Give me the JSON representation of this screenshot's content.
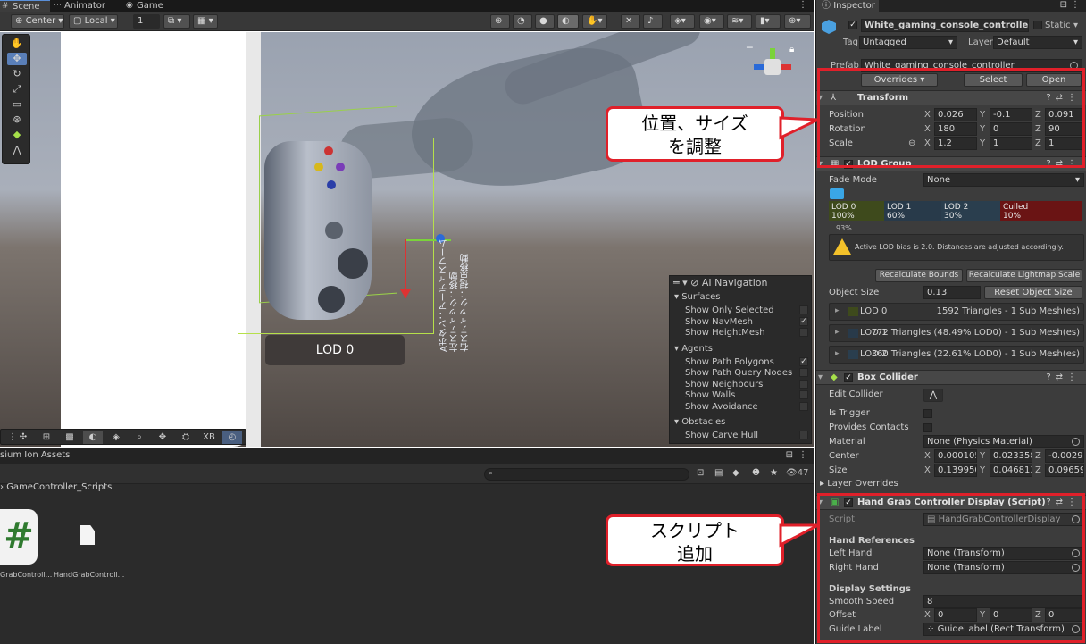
{
  "tabs": [
    {
      "label": "Scene",
      "icon": "hash-icon",
      "active": true
    },
    {
      "label": "Animator",
      "icon": "animator-icon"
    },
    {
      "label": "Game",
      "icon": "gamepad-icon"
    }
  ],
  "scene_toolbar": {
    "pivot": "Center",
    "space": "Local",
    "snap": "1"
  },
  "scene_view": {
    "lod_badge": "LOD 0",
    "jp_note": "Aボタン：アーディスフーム\n左スティック：移動\n右スティック：視点移動"
  },
  "ai_navigation": {
    "title": "AI Navigation",
    "surfaces_header": "Surfaces",
    "surfaces": [
      {
        "label": "Show Only Selected",
        "checked": false
      },
      {
        "label": "Show NavMesh",
        "checked": true
      },
      {
        "label": "Show HeightMesh",
        "checked": false
      }
    ],
    "agents_header": "Agents",
    "agents": [
      {
        "label": "Show Path Polygons",
        "checked": true
      },
      {
        "label": "Show Path Query Nodes",
        "checked": false
      },
      {
        "label": "Show Neighbours",
        "checked": false
      },
      {
        "label": "Show Walls",
        "checked": false
      },
      {
        "label": "Show Avoidance",
        "checked": false
      }
    ],
    "obstacles_header": "Obstacles",
    "obstacles": [
      {
        "label": "Show Carve Hull",
        "checked": false
      }
    ]
  },
  "bottom_toolbar": {
    "xb_label": "XB"
  },
  "assets": {
    "tab": "sium Ion Assets",
    "path": "GameController_Scripts",
    "count": "47",
    "files": [
      "GrabControll...",
      "HandGrabControll..."
    ]
  },
  "inspector": {
    "tab": "Inspector",
    "object_name": "White_gaming_console_controller",
    "static_label": "Static",
    "tag_label": "Tag",
    "tag_value": "Untagged",
    "layer_label": "Layer",
    "layer_value": "Default",
    "prefab_label": "Prefab",
    "prefab_value": "White_gaming_console_controller",
    "overrides": "Overrides",
    "select": "Select",
    "open": "Open",
    "transform": {
      "title": "Transform",
      "position": {
        "label": "Position",
        "x": "0.026",
        "y": "-0.1",
        "z": "0.091"
      },
      "rotation": {
        "label": "Rotation",
        "x": "180",
        "y": "0",
        "z": "90"
      },
      "scale": {
        "label": "Scale",
        "x": "1.2",
        "y": "1",
        "z": "1"
      }
    },
    "lod_group": {
      "title": "LOD Group",
      "fade_mode_label": "Fade Mode",
      "fade_mode_value": "None",
      "segments": [
        {
          "name": "LOD 0",
          "pct": "100%",
          "color": "#3e4a1c"
        },
        {
          "name": "LOD 1",
          "pct": "60%",
          "color": "#283a4a"
        },
        {
          "name": "LOD 2",
          "pct": "30%",
          "color": "#2a3e4e"
        },
        {
          "name": "Culled",
          "pct": "10%",
          "color": "#6a1414"
        }
      ],
      "camera_pct": "93%",
      "warning": "Active LOD bias is 2.0. Distances are adjusted accordingly.",
      "recalc_bounds": "Recalculate Bounds",
      "recalc_lightmap": "Recalculate Lightmap Scale",
      "object_size_label": "Object Size",
      "object_size_value": "0.13",
      "reset_size": "Reset Object Size",
      "lods": [
        {
          "name": "LOD 0",
          "tris": "1592 Triangles  - 1 Sub Mesh(es)"
        },
        {
          "name": "LOD 1",
          "tris": "772 Triangles (48.49% LOD0) - 1 Sub Mesh(es)"
        },
        {
          "name": "LOD 2",
          "tris": "360 Triangles (22.61% LOD0) - 1 Sub Mesh(es)"
        }
      ]
    },
    "box_collider": {
      "title": "Box Collider",
      "edit_collider": "Edit Collider",
      "is_trigger": "Is Trigger",
      "provides_contacts": "Provides Contacts",
      "material_label": "Material",
      "material_value": "None (Physics Material)",
      "center": {
        "label": "Center",
        "x": "0.000105",
        "y": "0.023358",
        "z": "-0.00298"
      },
      "size": {
        "label": "Size",
        "x": "0.139950",
        "y": "0.046813",
        "z": "0.096599"
      },
      "layer_overrides": "Layer Overrides"
    },
    "script_comp": {
      "title": "Hand Grab Controller Display (Script)",
      "script_label": "Script",
      "script_value": "HandGrabControllerDisplay",
      "hand_refs": "Hand References",
      "left_hand_label": "Left Hand",
      "left_hand_value": "None (Transform)",
      "right_hand_label": "Right Hand",
      "right_hand_value": "None (Transform)",
      "display_settings": "Display Settings",
      "smooth_label": "Smooth Speed",
      "smooth_value": "8",
      "offset": {
        "label": "Offset",
        "x": "0",
        "y": "0",
        "z": "0"
      },
      "guide_label": "Guide Label",
      "guide_value": "GuideLabel (Rect Transform)"
    }
  },
  "callouts": {
    "top": "位置、サイズ\nを調整",
    "bottom": "スクリプト\n追加"
  },
  "colors": {
    "highlight": "#e0202a",
    "bounds_green": "#b6e04a"
  }
}
